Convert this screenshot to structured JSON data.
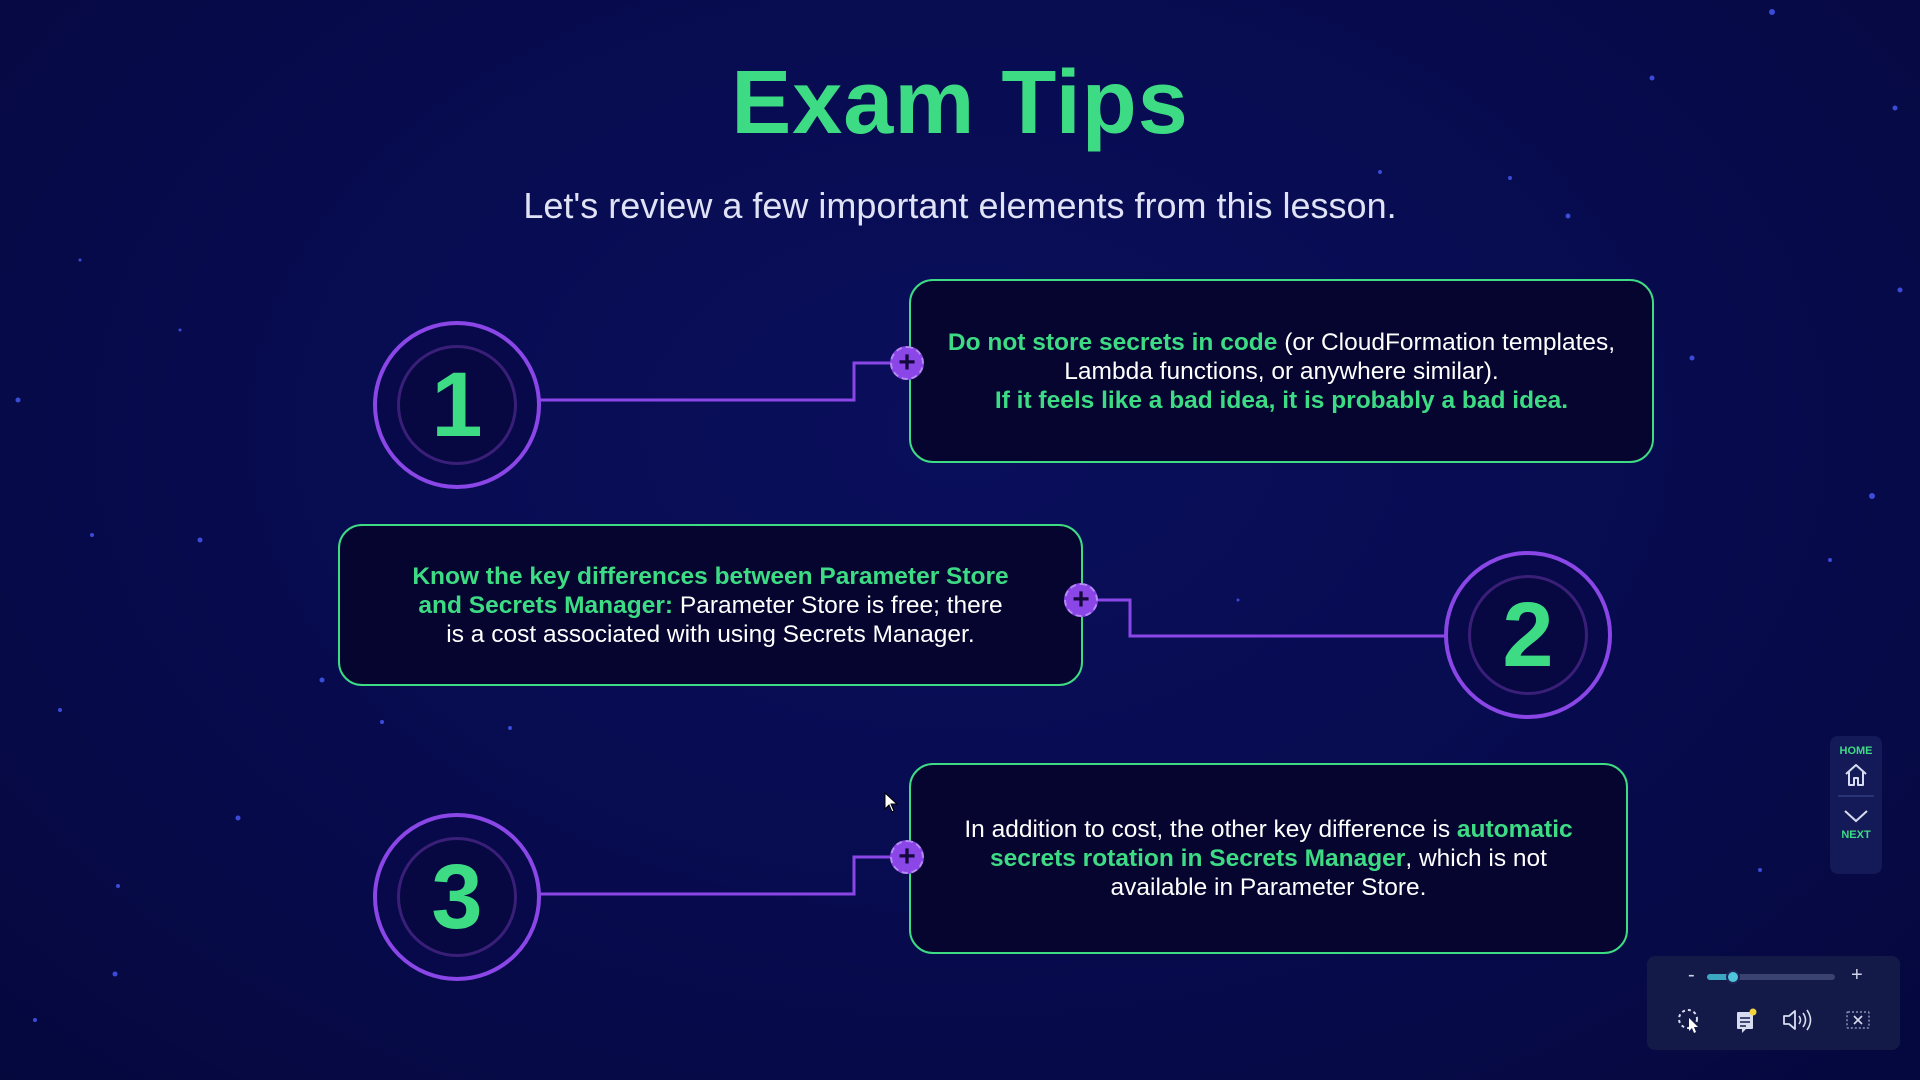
{
  "title": "Exam Tips",
  "subtitle": "Let's review a few important elements from this lesson.",
  "tips": [
    {
      "number": "1",
      "highlight_1": "Do not store secrets in code",
      "text_1": " (or CloudFormation templates, Lambda functions, or anywhere similar).",
      "highlight_2": "If it feels like a bad idea, it is probably a bad idea."
    },
    {
      "number": "2",
      "highlight_1": "Know the key differences between Parameter Store and Secrets Manager:",
      "text_1": " Parameter Store is free; there is a cost associated with using Secrets Manager."
    },
    {
      "number": "3",
      "text_1": "In addition to cost, the other key difference is ",
      "highlight_1": "automatic secrets rotation in Secrets Manager",
      "text_2": ", which is not available in Parameter Store."
    }
  ],
  "nav": {
    "home_label": "HOME",
    "next_label": "NEXT"
  },
  "player": {
    "volume_minus": "-",
    "volume_plus": "+",
    "volume_level": 0.2,
    "icons": [
      "pointer-select-icon",
      "notes-icon",
      "volume-icon",
      "close-captions-icon"
    ]
  },
  "colors": {
    "accent_green": "#3ddc84",
    "accent_purple": "#8b46e8",
    "background": "#070b4e"
  }
}
